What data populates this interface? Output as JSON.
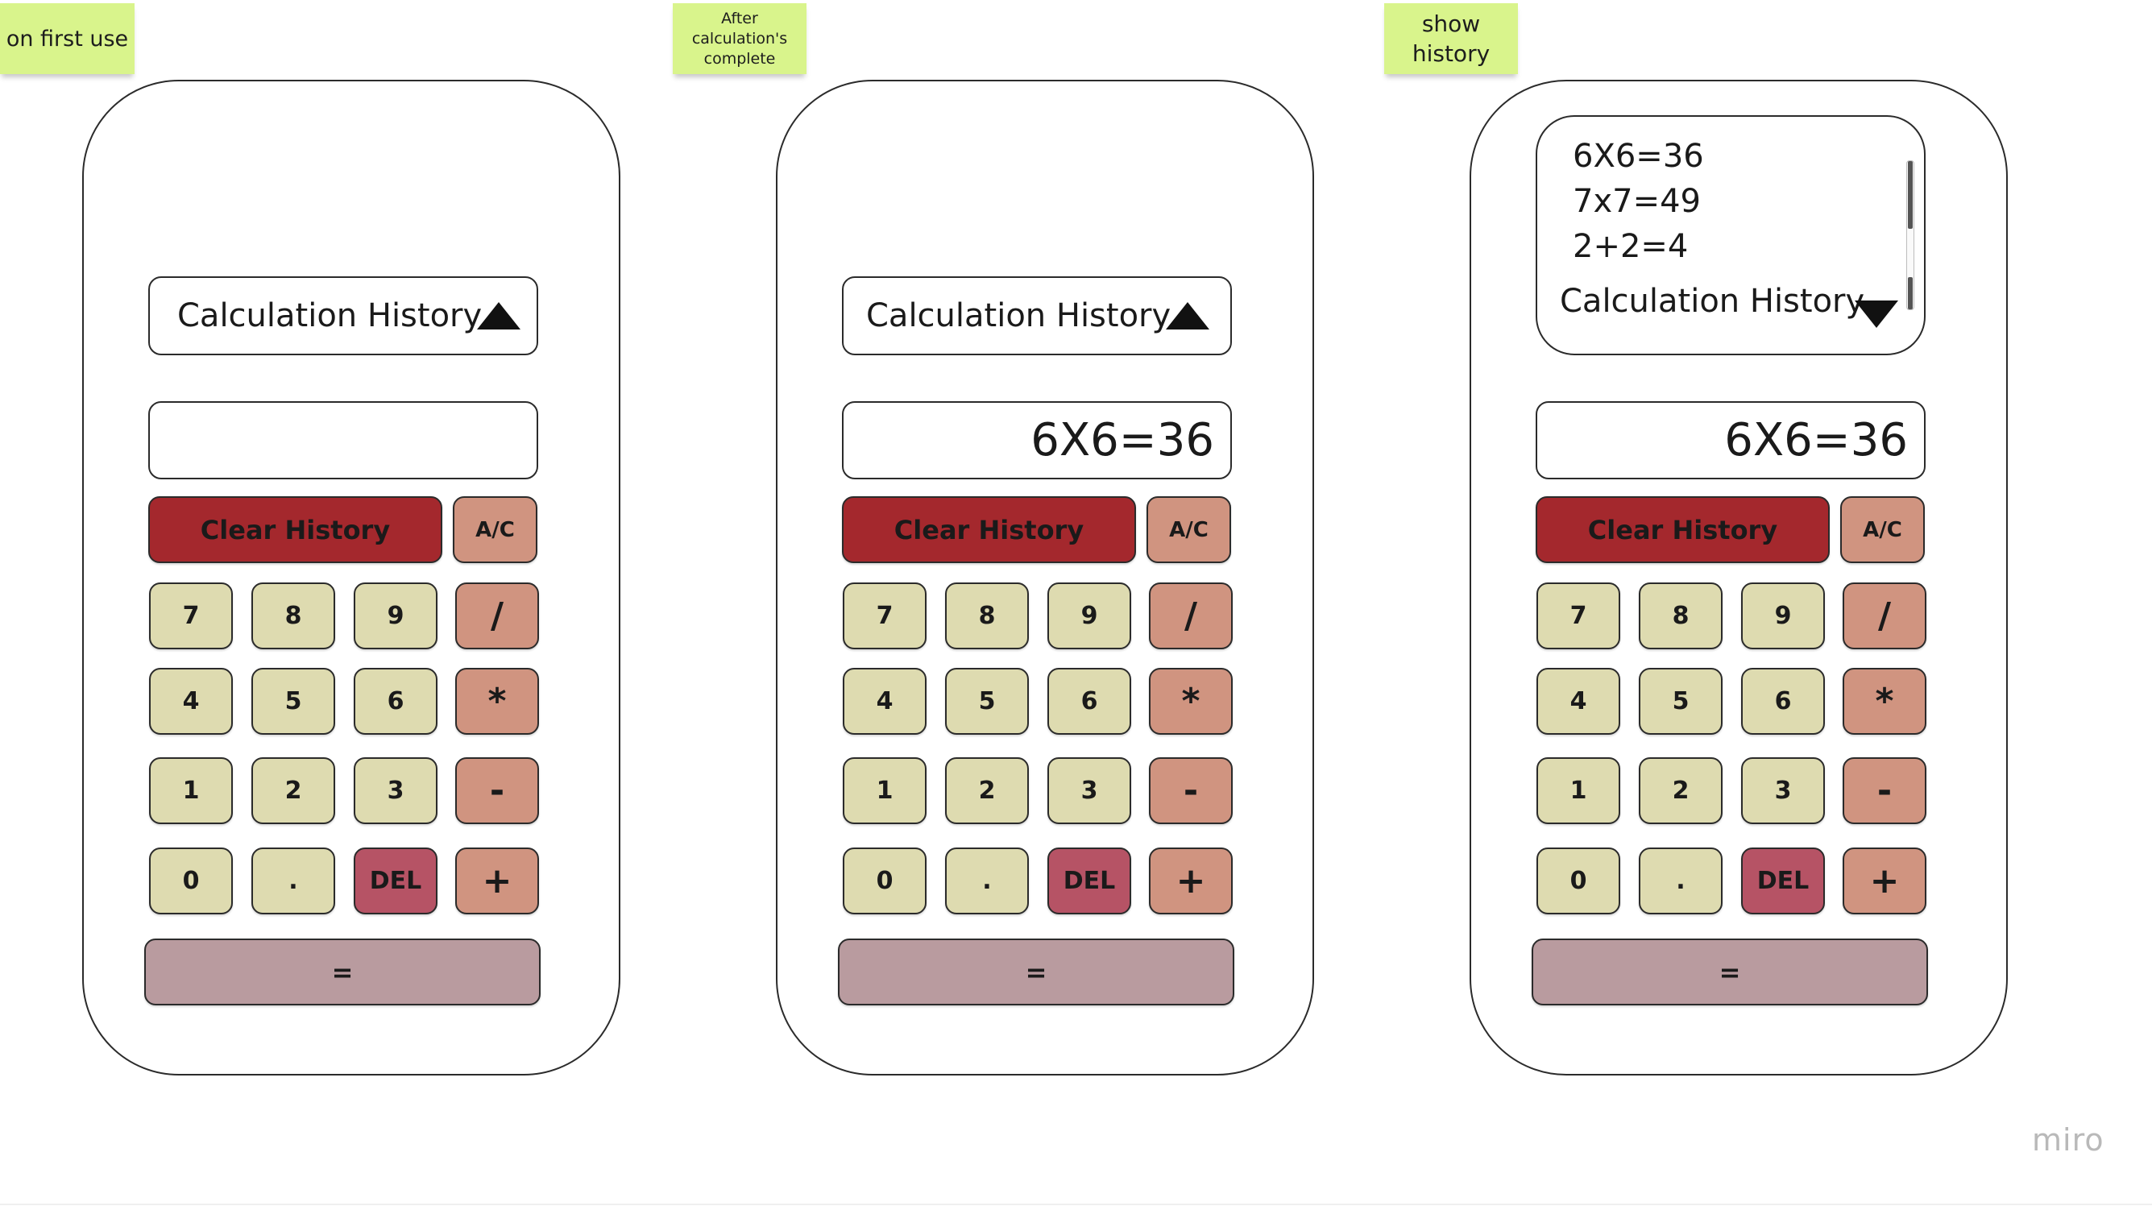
{
  "stickies": [
    {
      "text": "on first use"
    },
    {
      "text": "After calculation's complete"
    },
    {
      "text": "show history"
    }
  ],
  "history": {
    "label": "Calculation History",
    "entries": [
      "6X6=36",
      "7x7=49",
      "2+2=4"
    ]
  },
  "screens": [
    {
      "display": ""
    },
    {
      "display": "6X6=36"
    },
    {
      "display": "6X6=36"
    }
  ],
  "buttons": {
    "clear_history": "Clear History",
    "ac": "A/C",
    "seven": "7",
    "eight": "8",
    "nine": "9",
    "divide": "/",
    "four": "4",
    "five": "5",
    "six": "6",
    "multiply": "*",
    "one": "1",
    "two": "2",
    "three": "3",
    "minus": "-",
    "zero": "0",
    "dot": ".",
    "del": "DEL",
    "plus": "+",
    "equals": "="
  },
  "colors": {
    "sticky": "#d9f48c",
    "clear_history": "#a4282d",
    "operator": "#d09480",
    "number": "#dedbb0",
    "delete": "#b65365",
    "equals": "#b99b9f"
  },
  "branding": {
    "watermark": "miro"
  }
}
